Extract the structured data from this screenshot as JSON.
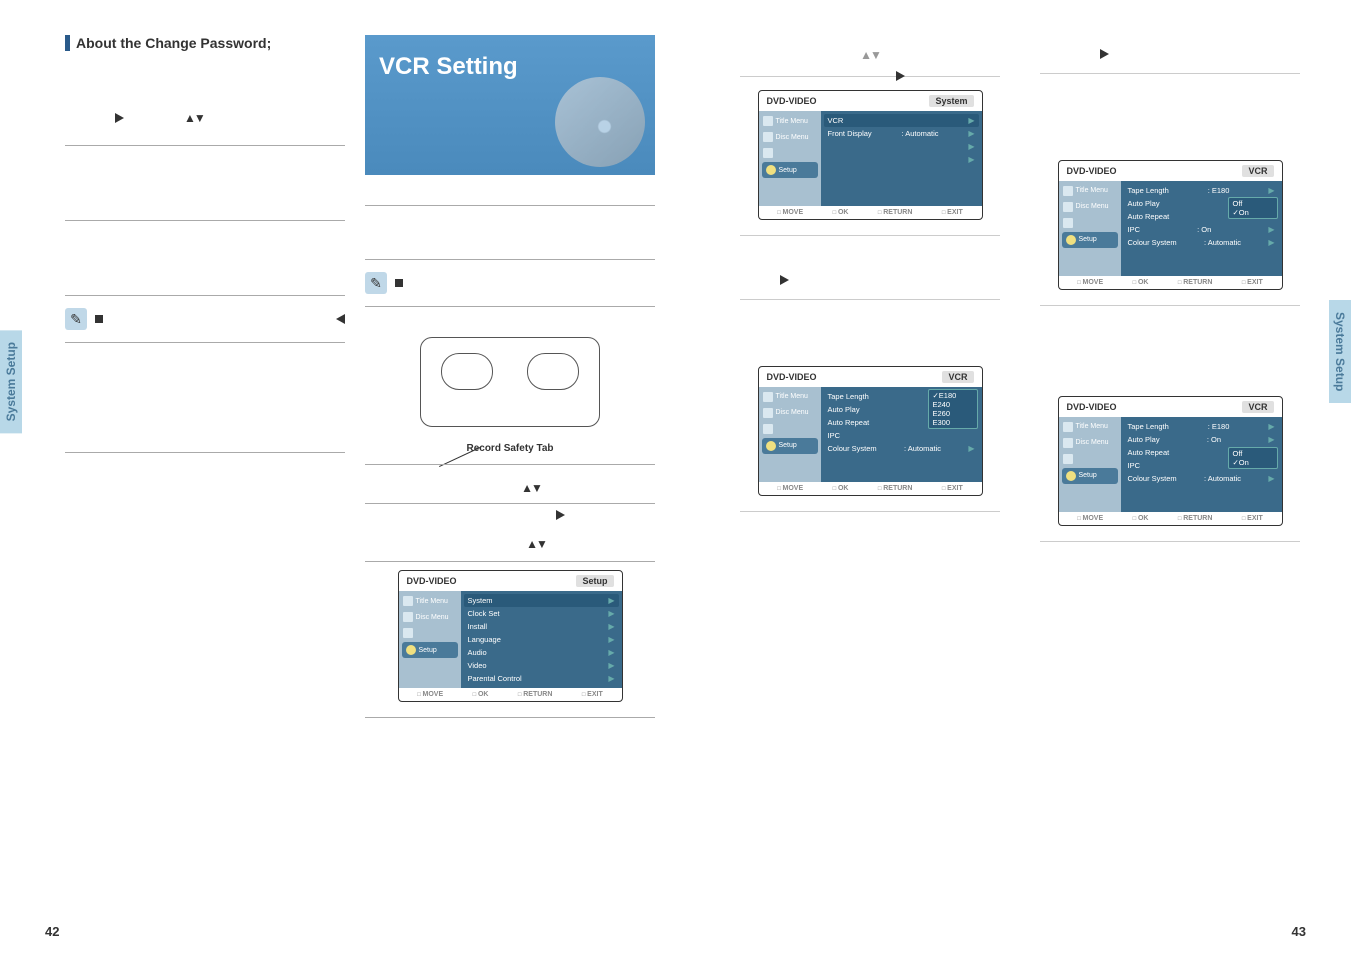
{
  "left_page": {
    "heading": "About the Change Password;",
    "side_tab": "System Setup",
    "page_number": "42"
  },
  "right_col_left_page": {
    "title_banner": "VCR Setting",
    "vcr_caption": "Record Safety Tab",
    "osd_setup": {
      "title": "DVD-VIDEO",
      "breadcrumb": "Setup",
      "items": [
        "System",
        "Clock Set",
        "Install",
        "Language",
        "Audio",
        "Video",
        "Parental Control"
      ],
      "sidebar": [
        "Title Menu",
        "Disc Menu",
        "",
        "Setup"
      ],
      "footer": [
        "MOVE",
        "OK",
        "RETURN",
        "EXIT"
      ]
    }
  },
  "right_page": {
    "side_tab": "System Setup",
    "page_number": "43",
    "osd_system": {
      "title": "DVD-VIDEO",
      "breadcrumb": "System",
      "sidebar": [
        "Title Menu",
        "Disc Menu",
        "",
        "Setup"
      ],
      "rows": [
        {
          "label": "VCR",
          "value": ""
        },
        {
          "label": "Front Display",
          "value": ": Automatic"
        }
      ],
      "footer": [
        "MOVE",
        "OK",
        "RETURN",
        "EXIT"
      ]
    },
    "osd_vcr_tape": {
      "title": "DVD-VIDEO",
      "breadcrumb": "VCR",
      "sidebar": [
        "Title Menu",
        "Disc Menu",
        "",
        "Setup"
      ],
      "rows": [
        {
          "label": "Tape Length",
          "options": [
            "E180",
            "E240",
            "E260",
            "E300"
          ],
          "selected": "E180"
        },
        {
          "label": "Auto Play",
          "value": ""
        },
        {
          "label": "Auto Repeat",
          "value": ""
        },
        {
          "label": "IPC",
          "value": ""
        },
        {
          "label": "Colour System",
          "value": ": Automatic"
        }
      ],
      "footer": [
        "MOVE",
        "OK",
        "RETURN",
        "EXIT"
      ]
    },
    "osd_vcr_autorepeat": {
      "title": "DVD-VIDEO",
      "breadcrumb": "VCR",
      "sidebar": [
        "Title Menu",
        "Disc Menu",
        "",
        "Setup"
      ],
      "rows": [
        {
          "label": "Tape Length",
          "value": ": E180"
        },
        {
          "label": "Auto Play",
          "value": ""
        },
        {
          "label": "Auto Repeat",
          "options": [
            "Off",
            "On"
          ],
          "selected": "On"
        },
        {
          "label": "IPC",
          "value": ": On"
        },
        {
          "label": "Colour System",
          "value": ": Automatic"
        }
      ],
      "footer": [
        "MOVE",
        "OK",
        "RETURN",
        "EXIT"
      ]
    },
    "osd_vcr_ipc": {
      "title": "DVD-VIDEO",
      "breadcrumb": "VCR",
      "sidebar": [
        "Title Menu",
        "Disc Menu",
        "",
        "Setup"
      ],
      "rows": [
        {
          "label": "Tape Length",
          "value": ": E180"
        },
        {
          "label": "Auto Play",
          "value": ": On"
        },
        {
          "label": "Auto Repeat",
          "value": ""
        },
        {
          "label": "IPC",
          "options": [
            "Off",
            "On"
          ],
          "selected": "On"
        },
        {
          "label": "Colour System",
          "value": ": Automatic"
        }
      ],
      "footer": [
        "MOVE",
        "OK",
        "RETURN",
        "EXIT"
      ]
    }
  }
}
